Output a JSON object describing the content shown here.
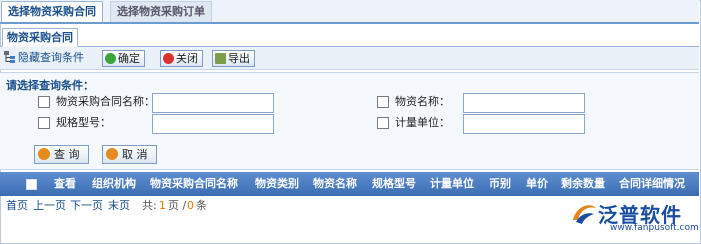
{
  "top_tabs": [
    {
      "label": "选择物资采购合同",
      "active": true
    },
    {
      "label": "选择物资采购订单",
      "active": false
    }
  ],
  "section_tab": "物资采购合同",
  "toolbar": {
    "toggle_label": "隐藏查询条件",
    "confirm_label": "确定",
    "close_label": "关闭",
    "export_label": "导出"
  },
  "query": {
    "title": "请选择查询条件：",
    "fields": [
      {
        "label": "物资采购合同名称：",
        "value": "",
        "checked": false
      },
      {
        "label": "物资名称：",
        "value": "",
        "checked": false
      },
      {
        "label": "规格型号：",
        "value": "",
        "checked": false
      },
      {
        "label": "计量单位：",
        "value": "",
        "checked": false
      }
    ],
    "search_label": "查 询",
    "cancel_label": "取 消"
  },
  "grid": {
    "columns": [
      "查看",
      "组织机构",
      "物资采购合同名称",
      "物资类别",
      "物资名称",
      "规格型号",
      "计量单位",
      "币别",
      "单价",
      "剩余数量",
      "合同详细情况"
    ]
  },
  "pager": {
    "first": "首页",
    "prev": "上一页",
    "next": "下一页",
    "last": "末页",
    "total_prefix": "共:",
    "page_count": "1",
    "page_suffix": "页 /",
    "record_count": "0",
    "record_suffix": "条"
  },
  "logo": {
    "name": "泛普软件",
    "url": "www.fanpusoft.com"
  },
  "colors": {
    "accent": "#1b4f8c",
    "grid_header": "#4a7cc0",
    "pager_number": "#e07a00"
  }
}
